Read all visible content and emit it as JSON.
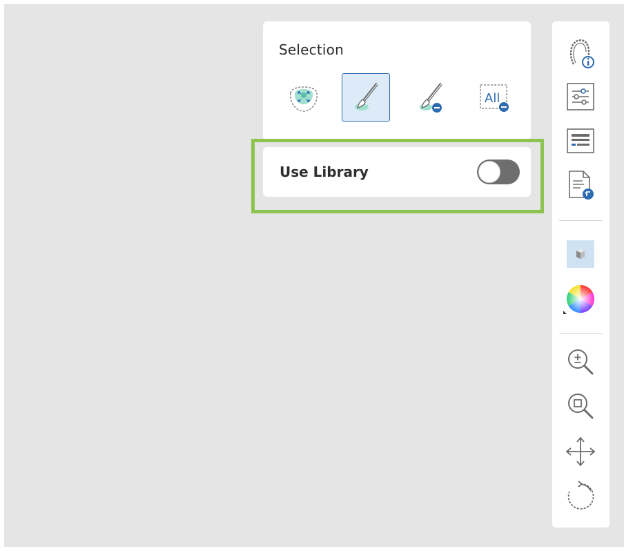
{
  "selection_panel": {
    "title": "Selection",
    "tools": [
      {
        "icon": "auto-select-icon",
        "active": false
      },
      {
        "icon": "brush-paint-icon",
        "active": true
      },
      {
        "icon": "brush-erase-icon",
        "active": false
      },
      {
        "icon": "select-all-icon",
        "label": "All",
        "active": false
      }
    ]
  },
  "library_panel": {
    "label": "Use Library",
    "toggle_on": false
  },
  "right_toolbar": {
    "items": [
      "jaw-info-icon",
      "sliders-settings-icon",
      "keyboard-icon",
      "document-export-icon",
      "cube-view-icon",
      "color-wheel-icon",
      "zoom-in-icon",
      "zoom-fit-icon",
      "pan-move-icon",
      "rotate-icon"
    ]
  },
  "colors": {
    "highlight": "#8dc44f",
    "accent": "#2d6bb0",
    "selection_fill": "#9fe0cf"
  }
}
